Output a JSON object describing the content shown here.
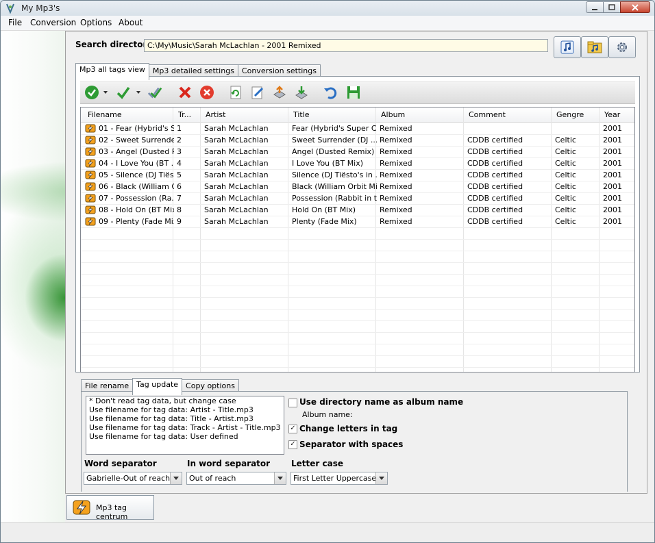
{
  "window": {
    "title": "My Mp3's"
  },
  "menu": {
    "items": [
      "File",
      "Conversion",
      "Options",
      "About"
    ],
    "mnemonics": [
      "F",
      "C",
      "O",
      "A"
    ]
  },
  "search": {
    "label": "Search directory",
    "value": "C:\\My\\Music\\Sarah McLachlan - 2001 Remixed"
  },
  "main_tabs": [
    "Mp3 all tags view",
    "Mp3 detailed settings",
    "Conversion settings"
  ],
  "grid": {
    "columns": [
      "Filename",
      "Tr...",
      "Artist",
      "Title",
      "Album",
      "Comment",
      "Gengre",
      "Year"
    ],
    "rows": [
      [
        "01 - Fear (Hybrid's S...",
        "1",
        "Sarah McLachlan",
        "Fear (Hybrid's Super C...",
        "Remixed",
        "",
        "",
        "2001"
      ],
      [
        "02 - Sweet Surrende...",
        "2",
        "Sarah McLachlan",
        "Sweet Surrender (DJ ...",
        "Remixed",
        "CDDB certified",
        "Celtic",
        "2001"
      ],
      [
        "03 - Angel (Dusted R...",
        "3",
        "Sarah McLachlan",
        "Angel (Dusted Remix)",
        "Remixed",
        "CDDB certified",
        "Celtic",
        "2001"
      ],
      [
        "04 - I Love You (BT ...",
        "4",
        "Sarah McLachlan",
        "I Love You (BT Mix)",
        "Remixed",
        "CDDB certified",
        "Celtic",
        "2001"
      ],
      [
        "05 - Silence (DJ Tiës...",
        "5",
        "Sarah McLachlan",
        "Silence (DJ Tiësto's in ...",
        "Remixed",
        "CDDB certified",
        "Celtic",
        "2001"
      ],
      [
        "06 - Black (William O...",
        "6",
        "Sarah McLachlan",
        "Black (William Orbit Mix)",
        "Remixed",
        "CDDB certified",
        "Celtic",
        "2001"
      ],
      [
        "07 - Possession (Ra...",
        "7",
        "Sarah McLachlan",
        "Possession (Rabbit in t...",
        "Remixed",
        "CDDB certified",
        "Celtic",
        "2001"
      ],
      [
        "08 - Hold On (BT Mix)",
        "8",
        "Sarah McLachlan",
        "Hold On (BT Mix)",
        "Remixed",
        "CDDB certified",
        "Celtic",
        "2001"
      ],
      [
        "09 - Plenty (Fade Mix)",
        "9",
        "Sarah McLachlan",
        "Plenty (Fade Mix)",
        "Remixed",
        "CDDB certified",
        "Celtic",
        "2001"
      ]
    ]
  },
  "sub_tabs": [
    "File rename",
    "Tag update",
    "Copy options"
  ],
  "tag_update": {
    "options": [
      "* Don't read tag data, but change case",
      "Use filename for tag data: Artist - Title.mp3",
      "Use filename for tag data: Title - Artist.mp3",
      "Use filename for tag data: Track - Artist - Title.mp3",
      "Use filename for tag data: User defined"
    ],
    "use_dir_album": {
      "label": "Use directory name as album name",
      "checked": false
    },
    "album_name_label": "Album name:",
    "change_letters": {
      "label": "Change letters in tag",
      "checked": true
    },
    "separator_spaces": {
      "label": "Separator with spaces",
      "checked": true
    },
    "word_separator": {
      "label": "Word separator",
      "value": "Gabrielle-Out of reach"
    },
    "in_word_separator": {
      "label": "In word separator",
      "value": "Out of reach"
    },
    "letter_case": {
      "label": "Letter case",
      "value": "First Letter Uppercase..."
    }
  },
  "bottom_tab": {
    "label": "Mp3 tag centrum"
  },
  "icons": {
    "toolbar": [
      "check-all-icon",
      "check-icon",
      "check-double-icon",
      "delete-icon",
      "cancel-icon",
      "refresh-icon",
      "edit-icon",
      "export-icon",
      "import-icon",
      "undo-icon",
      "save-icon"
    ],
    "top_buttons": [
      "music-note-icon",
      "music-folder-icon",
      "settings-icon"
    ]
  }
}
